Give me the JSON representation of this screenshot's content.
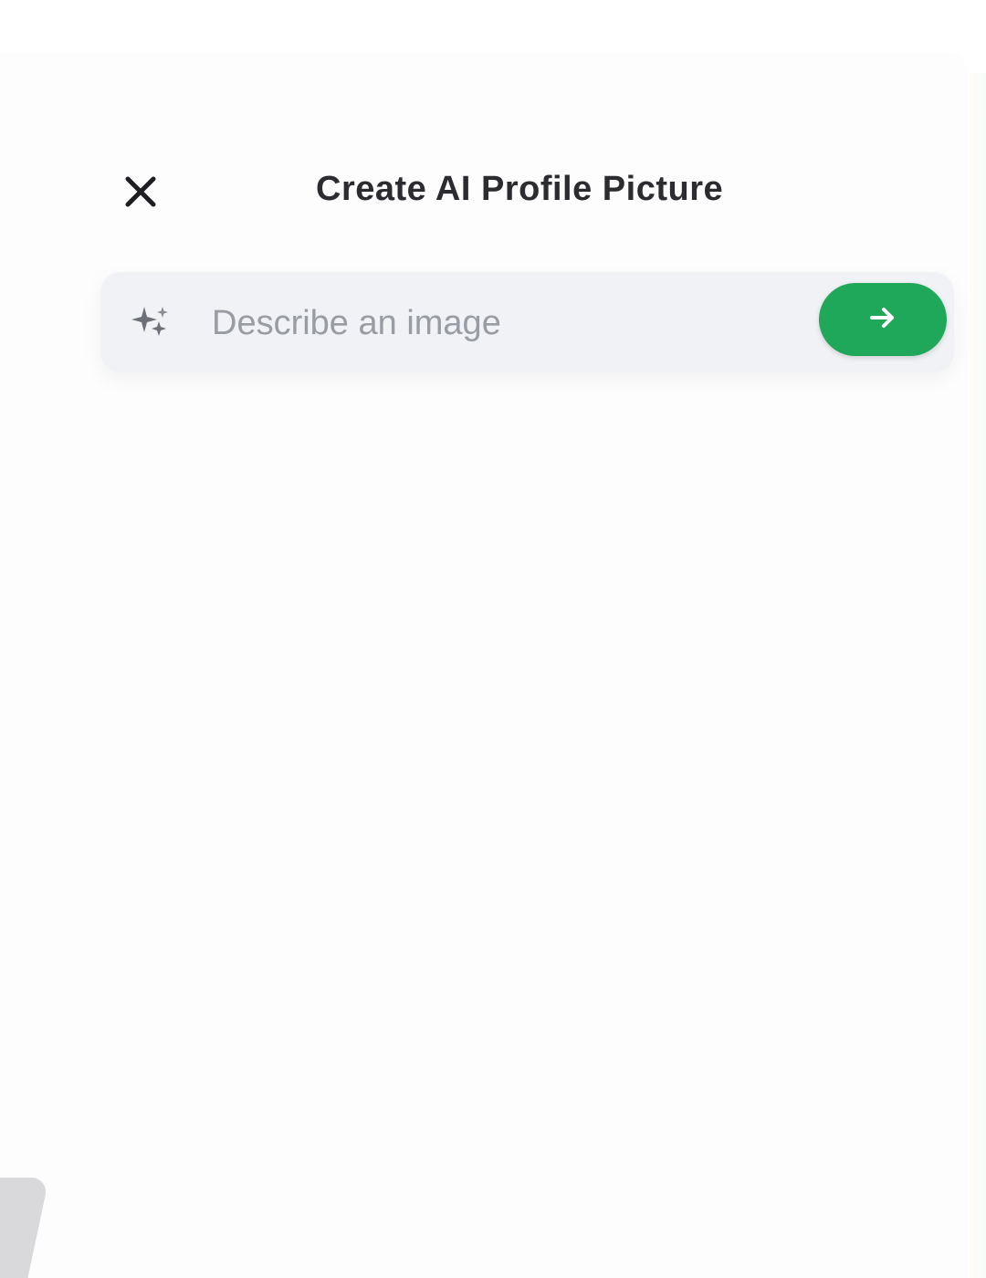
{
  "header": {
    "title": "Create AI Profile Picture",
    "close_icon": "close-icon"
  },
  "prompt": {
    "placeholder": "Describe an image",
    "value": "",
    "leading_icon": "sparkle-icon",
    "submit_icon": "arrow-right-icon"
  },
  "colors": {
    "accent": "#1fa85a",
    "title_text": "#2b2b30",
    "input_background": "#f1f2f6",
    "placeholder_text": "#9a9ca4"
  }
}
